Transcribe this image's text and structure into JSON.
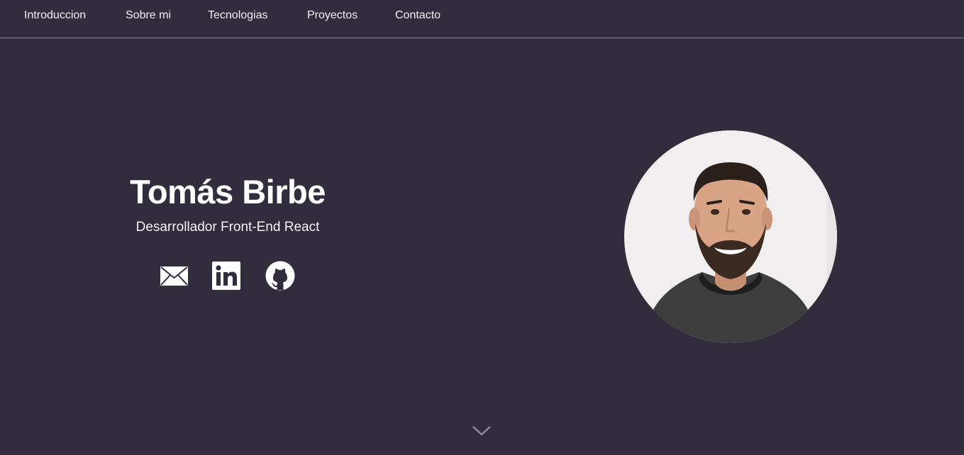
{
  "nav": {
    "items": [
      {
        "label": "Introduccion"
      },
      {
        "label": "Sobre mi"
      },
      {
        "label": "Tecnologias"
      },
      {
        "label": "Proyectos"
      },
      {
        "label": "Contacto"
      }
    ]
  },
  "hero": {
    "name": "Tomás Birbe",
    "role": "Desarrollador Front-End React",
    "social": [
      {
        "icon": "mail-icon"
      },
      {
        "icon": "linkedin-icon"
      },
      {
        "icon": "github-icon"
      }
    ],
    "avatar_icon": "profile-photo"
  },
  "scroll": {
    "icon": "chevron-down-icon"
  },
  "colors": {
    "background": "#312d3d",
    "text": "#ffffff",
    "divider": "#8a8796"
  }
}
